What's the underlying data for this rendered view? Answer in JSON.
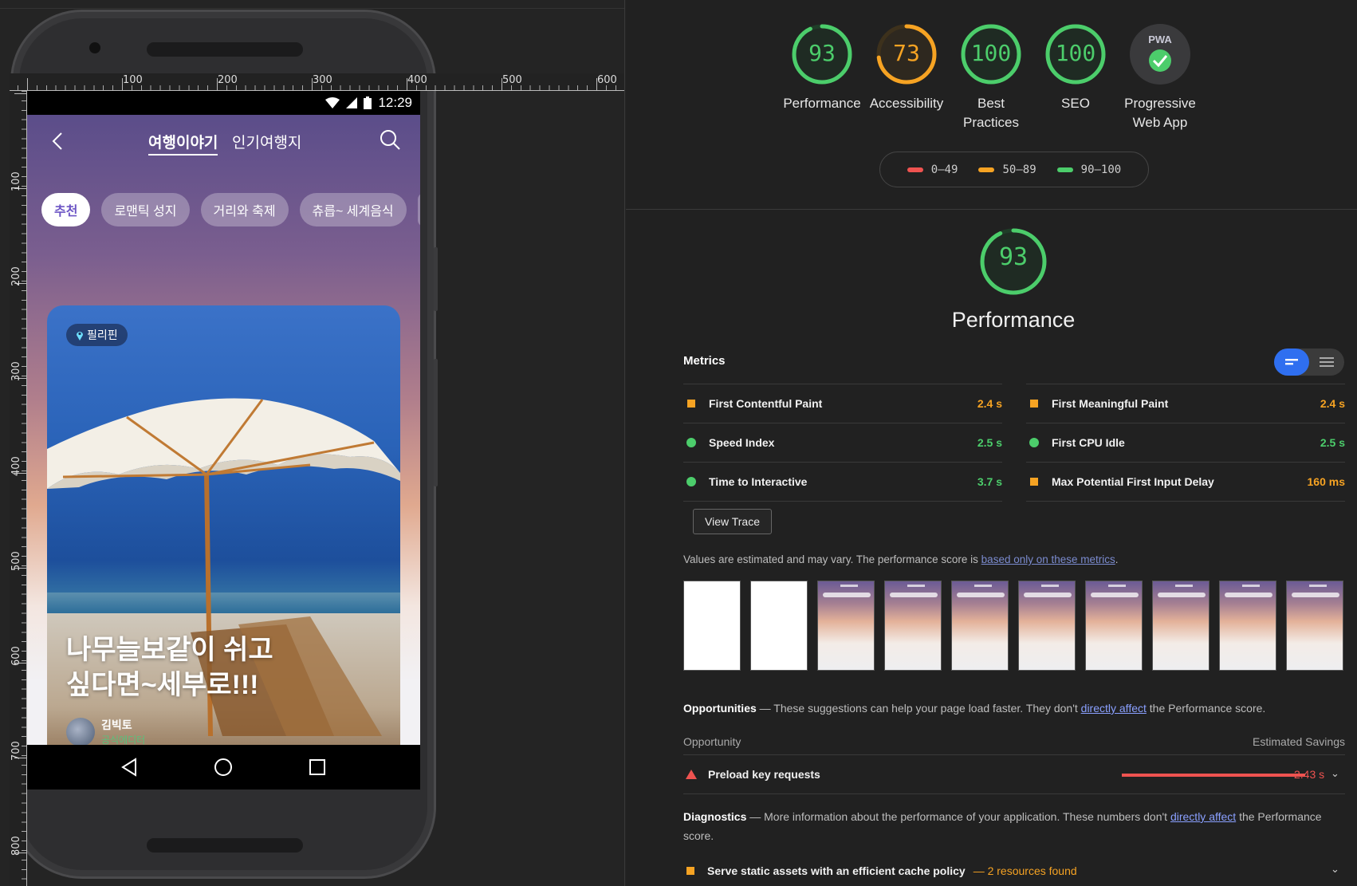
{
  "device": {
    "status_time": "12:29",
    "ruler_h": [
      "100",
      "200",
      "300",
      "400",
      "500",
      "600"
    ],
    "ruler_v": [
      "100",
      "200",
      "300",
      "400",
      "500",
      "600",
      "700",
      "800"
    ]
  },
  "app": {
    "tabs": [
      {
        "label": "여행이야기",
        "active": true
      },
      {
        "label": "인기여행지",
        "active": false
      }
    ],
    "chips": [
      "추천",
      "로맨틱 성지",
      "거리와 축제",
      "츄릅~ 세계음식"
    ],
    "card": {
      "location": "필리핀",
      "title": "나무늘보같이 쉬고 싶다면~세부로!!!",
      "author_name": "김빅토",
      "author_role": "공식에디터"
    }
  },
  "report": {
    "categories": [
      {
        "score": "93",
        "label": "Performance",
        "color": "#4ccd6b",
        "fraction": 0.93
      },
      {
        "score": "73",
        "label": "Accessibility",
        "color": "#f6a323",
        "fraction": 0.73
      },
      {
        "score": "100",
        "label": "Best Practices",
        "color": "#4ccd6b",
        "fraction": 1.0
      },
      {
        "score": "100",
        "label": "SEO",
        "color": "#4ccd6b",
        "fraction": 1.0
      },
      {
        "score": "",
        "label": "Progressive Web App",
        "color": "#4ccd6b",
        "badge": "PWA"
      }
    ],
    "legend": [
      {
        "range": "0–49",
        "color": "#ef5350"
      },
      {
        "range": "50–89",
        "color": "#f6a323"
      },
      {
        "range": "90–100",
        "color": "#4ccd6b"
      }
    ],
    "performance_score": "93",
    "performance_fraction": 0.93,
    "performance_title": "Performance",
    "metrics_heading": "Metrics",
    "metrics": [
      {
        "name": "First Contentful Paint",
        "value": "2.4 s",
        "status": "average"
      },
      {
        "name": "First Meaningful Paint",
        "value": "2.4 s",
        "status": "average"
      },
      {
        "name": "Speed Index",
        "value": "2.5 s",
        "status": "pass"
      },
      {
        "name": "First CPU Idle",
        "value": "2.5 s",
        "status": "pass"
      },
      {
        "name": "Time to Interactive",
        "value": "3.7 s",
        "status": "pass"
      },
      {
        "name": "Max Potential First Input Delay",
        "value": "160 ms",
        "status": "average"
      }
    ],
    "view_trace": "View Trace",
    "note": "Values are estimated and may vary. The performance score is ",
    "note_link": "based only on these metrics",
    "note_end": ".",
    "opportunities_title": "Opportunities",
    "opportunities_desc": " — These suggestions can help your page load faster. They don't ",
    "opportunities_link": "directly affect",
    "opportunities_end": " the Performance score.",
    "opp_col1": "Opportunity",
    "opp_col2": "Estimated Savings",
    "opp_item": "Preload key requests",
    "opp_savings": "2.43 s",
    "diagnostics_title": "Diagnostics",
    "diagnostics_desc": " — More information about the performance of your application. These numbers don't ",
    "diagnostics_link": "directly affect",
    "diagnostics_end": " the Performance score.",
    "diag_item": "Serve static assets with an efficient cache policy",
    "diag_sub": "— 2 resources found"
  }
}
